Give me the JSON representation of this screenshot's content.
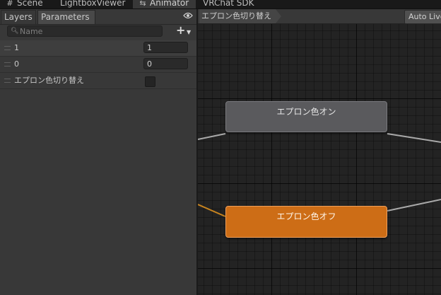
{
  "top_tabs": [
    {
      "label": "Scene",
      "icon": "grid-icon"
    },
    {
      "label": "LightboxViewer"
    },
    {
      "label": "Animator",
      "icon": "animator-icon",
      "active": true
    },
    {
      "label": "VRChat SDK"
    }
  ],
  "panel": {
    "tabs": [
      "Layers",
      "Parameters"
    ],
    "active_tab": "Parameters",
    "visibility_icon": "eye-icon",
    "search": {
      "placeholder": "Name",
      "value": ""
    },
    "add_button_icon": "plus-icon",
    "parameters": [
      {
        "name": "1",
        "value": "1",
        "type": "float"
      },
      {
        "name": "0",
        "value": "0",
        "type": "int"
      },
      {
        "name": "エプロン色切り替え",
        "value": false,
        "type": "bool"
      }
    ]
  },
  "graph": {
    "breadcrumb": "エプロン色切り替え",
    "auto_live_label": "Auto Live Link",
    "states": [
      {
        "name": "エプロン色オン",
        "default": false
      },
      {
        "name": "エプロン色オフ",
        "default": true
      }
    ]
  },
  "colors": {
    "default_state": "#cd6d16",
    "normal_state": "#5a5a5d",
    "transition_line": "#a9a9a9",
    "entry_line": "#c8841f"
  }
}
